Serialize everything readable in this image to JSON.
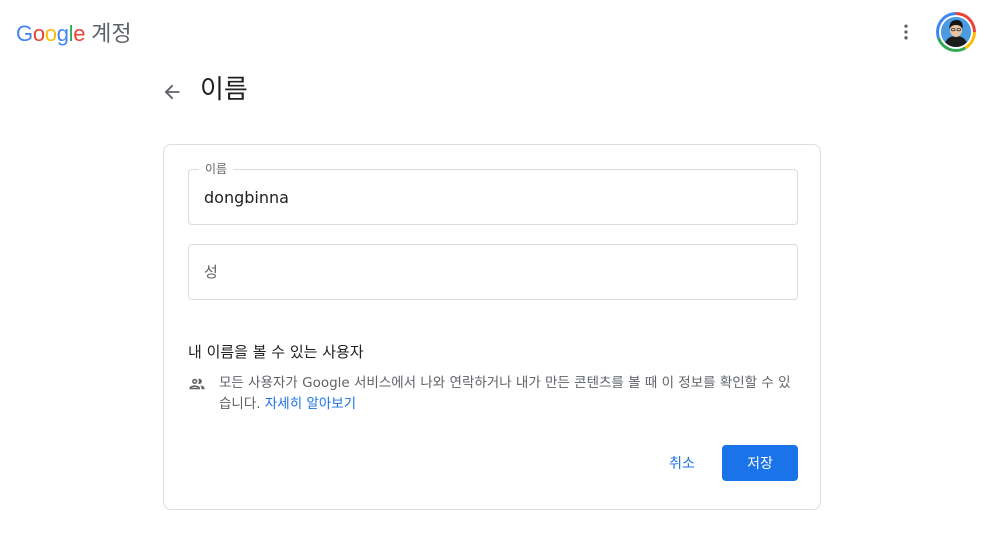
{
  "header": {
    "logo_letters": [
      "G",
      "o",
      "o",
      "g",
      "l",
      "e"
    ],
    "logo_colors": [
      "#4285f4",
      "#ea4335",
      "#fbbc05",
      "#4285f4",
      "#34a853",
      "#ea4335"
    ],
    "product_name": "계정",
    "more_icon": "more-vert-icon",
    "avatar_icon": "account-avatar"
  },
  "page": {
    "back_icon": "arrow-back-icon",
    "title": "이름"
  },
  "form": {
    "first_name": {
      "label": "이름",
      "value": "dongbinna"
    },
    "last_name": {
      "placeholder": "성",
      "value": ""
    }
  },
  "visibility": {
    "title": "내 이름을 볼 수 있는 사용자",
    "icon": "people-icon",
    "description": "모든 사용자가 Google 서비스에서 나와 연락하거나 내가 만든 콘텐츠를 볼 때 이 정보를 확인할 수 있습니다.",
    "learn_more": "자세히 알아보기"
  },
  "actions": {
    "cancel_label": "취소",
    "save_label": "저장"
  },
  "colors": {
    "accent": "#1a73e8",
    "border": "#dadce0",
    "text_secondary": "#5f6368"
  }
}
